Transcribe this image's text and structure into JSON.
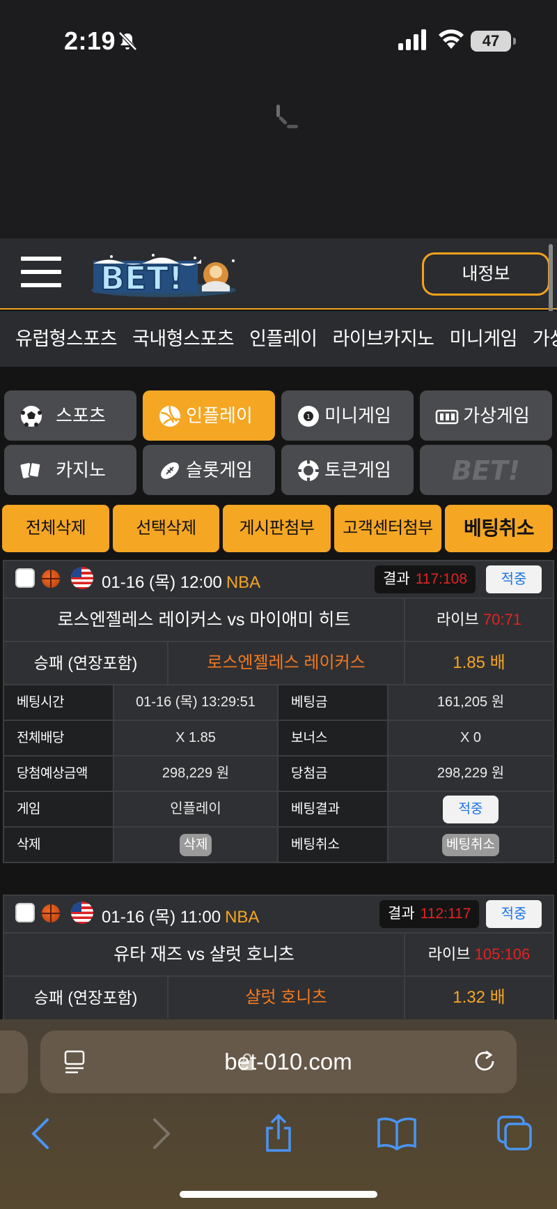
{
  "status_bar": {
    "time": "2:19",
    "battery": "47"
  },
  "header": {
    "logo_text": "BET!",
    "my_info_label": "내정보"
  },
  "menu": [
    "유럽형스포츠",
    "국내형스포츠",
    "인플레이",
    "라이브카지노",
    "미니게임",
    "가상게임"
  ],
  "categories": [
    {
      "label": "스포츠",
      "icon": "soccer-ball-icon",
      "active": false
    },
    {
      "label": "인플레이",
      "icon": "volleyball-icon",
      "active": true
    },
    {
      "label": "미니게임",
      "icon": "mini-game-icon",
      "active": false
    },
    {
      "label": "가상게임",
      "icon": "virtual-game-icon",
      "active": false
    },
    {
      "label": "카지노",
      "icon": "cards-icon",
      "active": false
    },
    {
      "label": "슬롯게임",
      "icon": "football-icon",
      "active": false
    },
    {
      "label": "토큰게임",
      "icon": "chip-icon",
      "active": false
    },
    {
      "label": "BET!",
      "icon": "bet-logo-icon",
      "active": false
    }
  ],
  "actions": [
    "전체삭제",
    "선택삭제",
    "게시판첨부",
    "고객센터첨부",
    "베팅취소"
  ],
  "bets": [
    {
      "datetime": "01-16 (목) 12:00",
      "league": "NBA",
      "result_label": "결과",
      "result_score": "117:108",
      "hit_label": "적중",
      "match": "로스엔젤레스 레이커스  vs  마이애미 히트",
      "live_label": "라이브",
      "live_score": "70:71",
      "market": "승패 (연장포함)",
      "pick": "로스엔젤레스 레이커스",
      "odds": "1.85 배",
      "details": {
        "bet_time_label": "베팅시간",
        "bet_time": "01-16 (목) 13:29:51",
        "bet_amount_label": "베팅금",
        "bet_amount": "161,205 원",
        "total_odds_label": "전체배당",
        "total_odds": "X 1.85",
        "bonus_label": "보너스",
        "bonus": "X 0",
        "expected_label": "당첨예상금액",
        "expected": "298,229 원",
        "win_label": "당첨금",
        "win": "298,229 원",
        "game_label": "게임",
        "game": "인플레이",
        "result_label": "베팅결과",
        "result": "적중",
        "delete_label": "삭제",
        "delete_btn": "삭제",
        "cancel_label": "베팅취소",
        "cancel_btn": "베팅취소"
      }
    },
    {
      "datetime": "01-16 (목) 11:00",
      "league": "NBA",
      "result_label": "결과",
      "result_score": "112:117",
      "hit_label": "적중",
      "match": "유타 재즈  vs  샬럿 호니츠",
      "live_label": "라이브",
      "live_score": "105:106",
      "market": "승패 (연장포함)",
      "pick": "샬럿 호니츠",
      "odds": "1.32 배"
    }
  ],
  "browser": {
    "url": "bet-010.com"
  }
}
